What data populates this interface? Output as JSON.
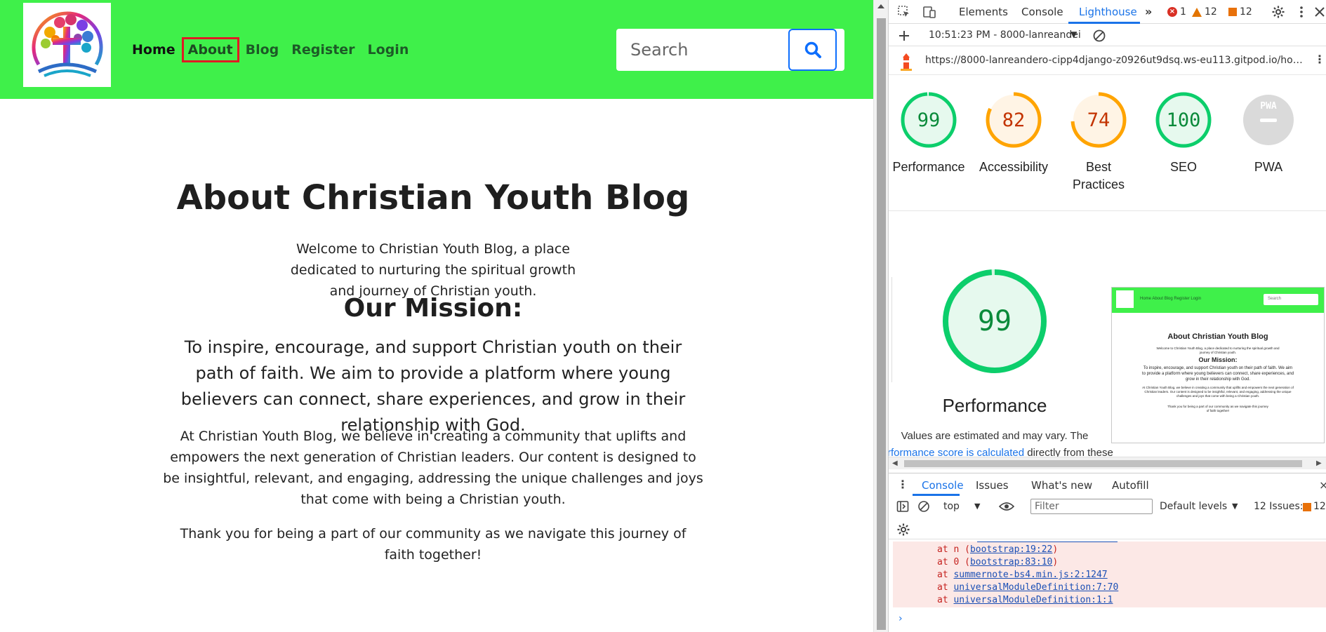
{
  "site": {
    "nav": {
      "items": [
        "Home",
        "About",
        "Blog",
        "Register",
        "Login"
      ],
      "active_item": "About"
    },
    "search": {
      "placeholder": "Search"
    },
    "colors": {
      "navbar": "#3ff04a",
      "search_button_border": "#0d6efd",
      "active_outline": "#e01b24"
    },
    "content": {
      "title": "About Christian Youth Blog",
      "welcome": "Welcome to Christian Youth Blog, a place dedicated to nurturing the spiritual growth and journey of Christian youth.",
      "mission_title": "Our Mission:",
      "mission_text": "To inspire, encourage, and support Christian youth on their path of faith. We aim to provide a platform where young believers can connect, share experiences, and grow in their relationship with God.",
      "believe": "At Christian Youth Blog, we believe in creating a community that uplifts and empowers the next generation of Christian leaders. Our content is designed to be insightful, relevant, and engaging, addressing the unique challenges and joys that come with being a Christian youth.",
      "thanks": "Thank you for being a part of our community as we navigate this journey of faith together!"
    }
  },
  "devtools": {
    "tabs": [
      "Elements",
      "Console",
      "Lighthouse"
    ],
    "active_tab": "Lighthouse",
    "errors_count": "1",
    "warnings_count": "12",
    "issues_count": "12",
    "report_time": "10:51:23 PM - 8000-lanreandei",
    "url": "https://8000-lanreandero-cipp4django-z0926ut9dsq.ws-eu113.gitpod.io/homea…",
    "scores": [
      {
        "label": "Performance",
        "score": "99",
        "value": 99,
        "color": "#0cce6b",
        "text_color": "#0a8a3a",
        "bg": "#e6f9ee"
      },
      {
        "label": "Accessibility",
        "score": "82",
        "value": 82,
        "color": "#ffa400",
        "text_color": "#c33300",
        "bg": "#fff4e5"
      },
      {
        "label": "Best Practices",
        "score": "74",
        "value": 74,
        "color": "#ffa400",
        "text_color": "#c33300",
        "bg": "#fff4e5"
      },
      {
        "label": "SEO",
        "score": "100",
        "value": 100,
        "color": "#0cce6b",
        "text_color": "#0a8a3a",
        "bg": "#e6f9ee"
      },
      {
        "label": "PWA",
        "score": "PWA",
        "value": 0,
        "color": "#dadada",
        "text_color": "#ffffff",
        "bg": "#dadada"
      }
    ],
    "detail": {
      "score": "99",
      "value": 99,
      "label": "Performance",
      "note": "Values are estimated and may vary. The",
      "link_prefix": "rformance score is calculated",
      "link_suffix": " directly from these"
    },
    "thumbnail": {
      "nav": "Home   About   Blog   Register   Login",
      "search": "Search",
      "title": "About Christian Youth Blog",
      "welcome": "Welcome to Christian Youth Blog, a place dedicated to nurturing the spiritual growth and journey of Christian youth.",
      "mission_title": "Our Mission:",
      "mission_text": "To inspire, encourage, and support Christian youth on their path of faith. We aim to provide a platform where young believers can connect, share experiences, and grow in their relationship with God.",
      "believe": "At Christian Youth Blog, we believe in creating a community that uplifts and empowers the next generation of Christian leaders. Our content is designed to be insightful, relevant, and engaging, addressing the unique challenges and joys that come with being a Christian youth.",
      "thanks": "Thank you for being a part of our community as we navigate this journey of faith together!"
    },
    "console_tabs": [
      "Console",
      "Issues",
      "What's new",
      "Autofill"
    ],
    "console_toolbar": {
      "context": "top",
      "filter_placeholder": "Filter",
      "levels": "Default levels",
      "issues": "12 Issues:",
      "issues_count": "12"
    },
    "error_lines": [
      {
        "prefix": "at n (",
        "link": "bootstrap:19:22",
        "suffix": ")"
      },
      {
        "prefix": "at 0 (",
        "link": "bootstrap:83:10",
        "suffix": ")"
      },
      {
        "prefix": "at ",
        "link": "summernote-bs4.min.js:2:1247",
        "suffix": ""
      },
      {
        "prefix": "at ",
        "link": "universalModuleDefinition:7:70",
        "suffix": ""
      },
      {
        "prefix": "at ",
        "link": "universalModuleDefinition:1:1",
        "suffix": ""
      }
    ]
  }
}
